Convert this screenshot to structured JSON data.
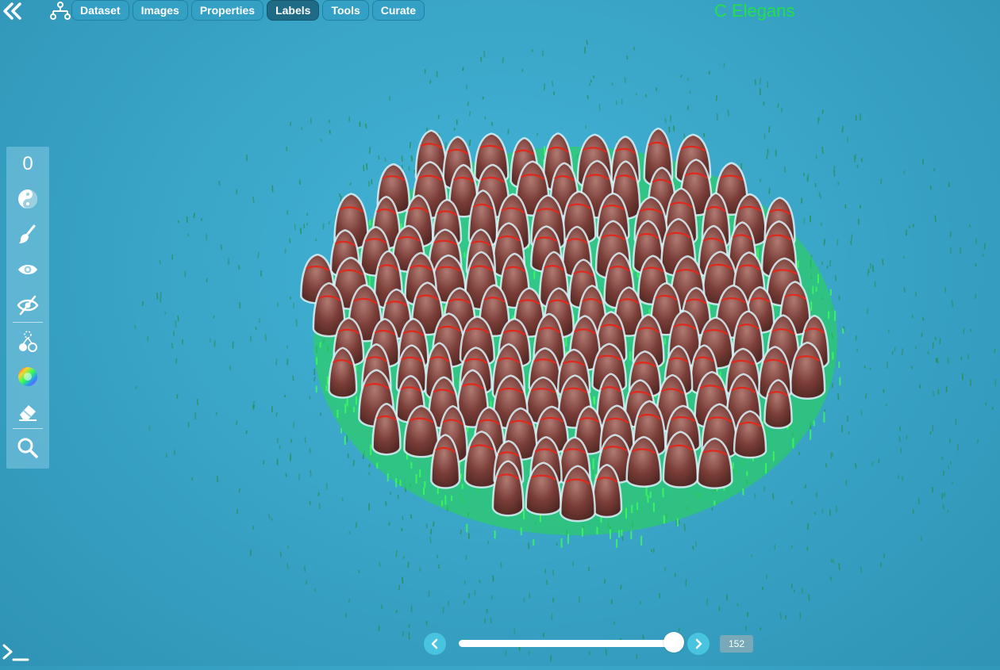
{
  "app_title": "C Elegans",
  "tabs": [
    {
      "label": "Dataset"
    },
    {
      "label": "Images"
    },
    {
      "label": "Properties"
    },
    {
      "label": "Labels"
    },
    {
      "label": "Tools"
    },
    {
      "label": "Curate"
    }
  ],
  "active_tab": "Labels",
  "toolbar": {
    "counter": "0",
    "tools": [
      "yin-yang-icon",
      "brush-icon",
      "eye-icon",
      "eye-off-icon",
      "hierarchy-icon",
      "color-wheel-icon",
      "eraser-icon",
      "search-icon"
    ]
  },
  "timeline": {
    "frame": "152",
    "position_fraction": 0.99
  },
  "colors": {
    "background": "#3aa6c8",
    "accent_green": "#22e04a",
    "active_tab": "#1f6a85",
    "cell": "#6f3a35",
    "cell_edge": "#dff6fb",
    "cell_core": "#d22a1e"
  },
  "icons": {
    "collapse": "double-chevron-left-icon",
    "tree": "tree-icon",
    "prev": "chevron-left-icon",
    "next": "chevron-right-icon",
    "console": "terminal-icon"
  }
}
